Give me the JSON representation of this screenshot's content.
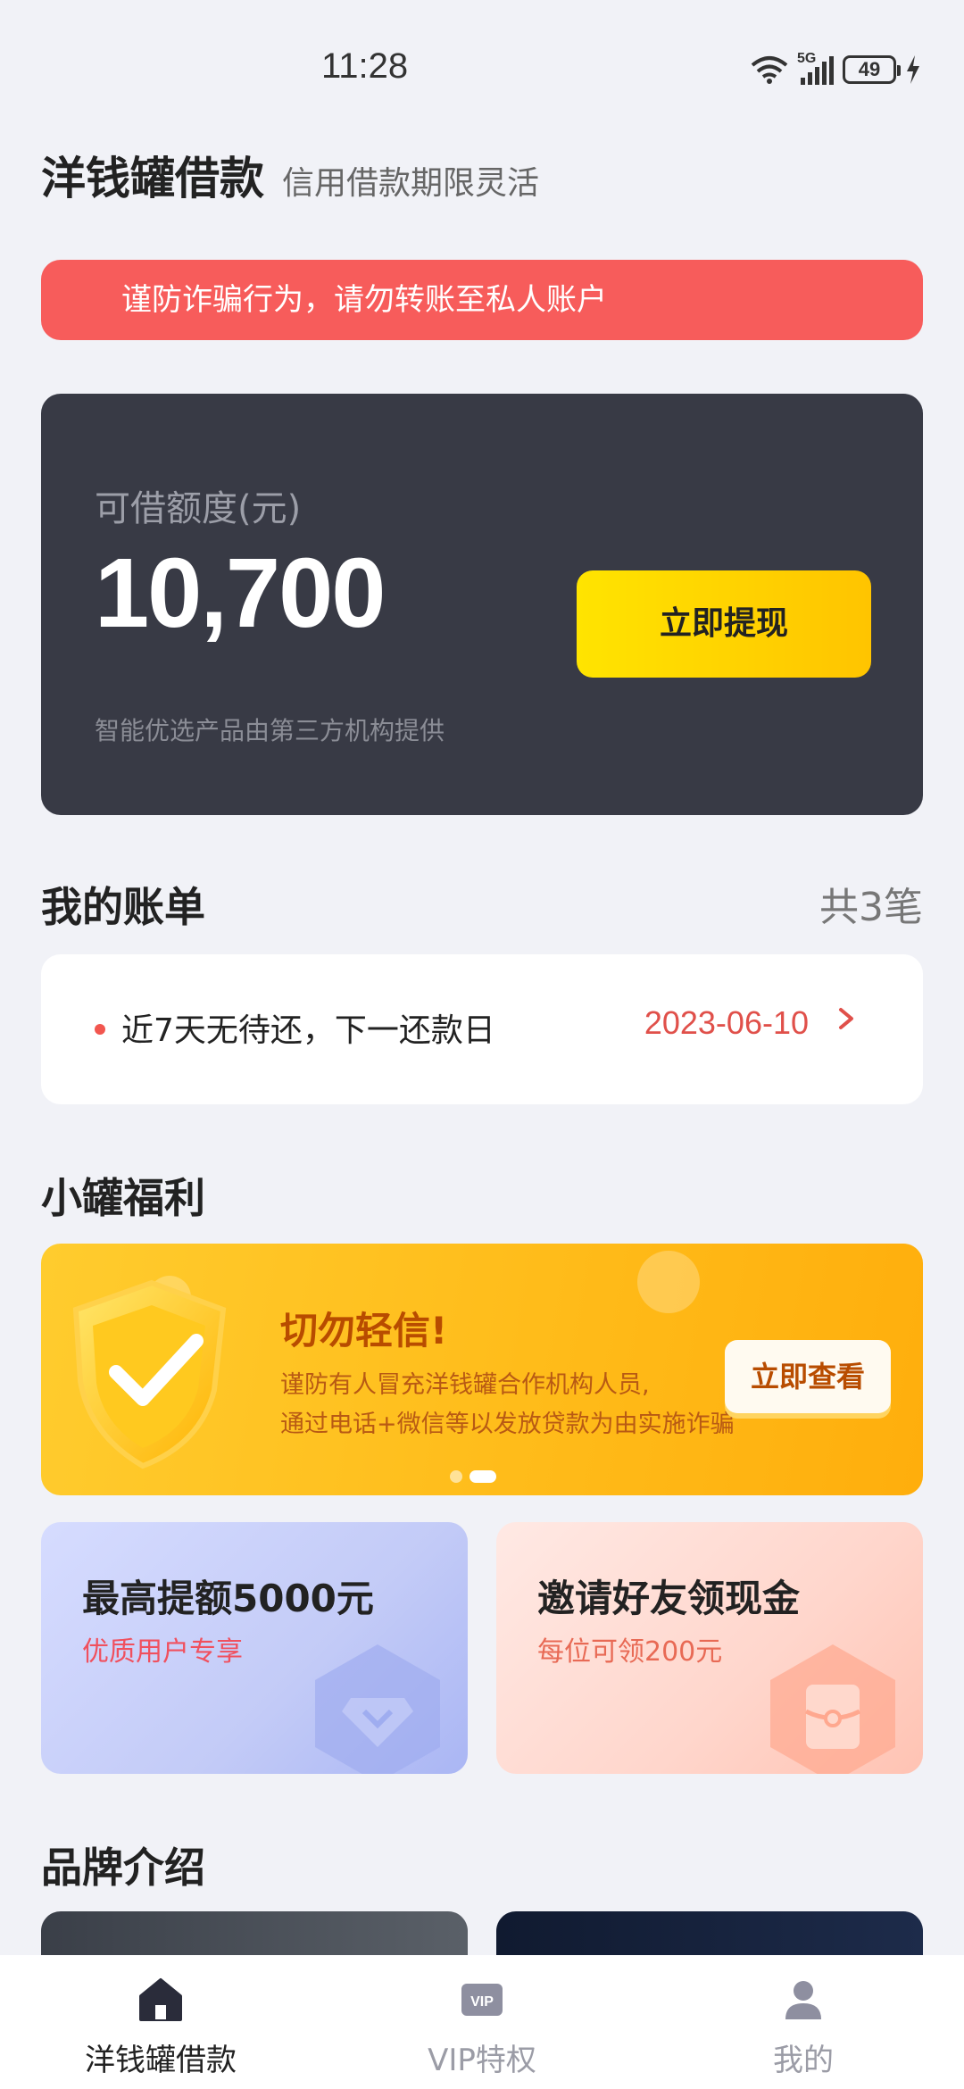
{
  "status_bar": {
    "time": "11:28",
    "network": "5G",
    "battery": "49"
  },
  "header": {
    "title": "洋钱罐借款",
    "subtitle": "信用借款期限灵活"
  },
  "warning": {
    "text": "谨防诈骗行为，请勿转账至私人账户"
  },
  "credit": {
    "label": "可借额度(元)",
    "amount": "10,700",
    "note": "智能优选产品由第三方机构提供",
    "withdraw_label": "立即提现"
  },
  "bills": {
    "title": "我的账单",
    "count": "共3笔",
    "status_text": "近7天无待还，下一还款日",
    "next_date": "2023-06-10"
  },
  "perks": {
    "title": "小罐福利",
    "banner": {
      "title": "切勿轻信!",
      "line1": "谨防有人冒充洋钱罐合作机构人员,",
      "line2": "通过电话+微信等以发放贷款为由实施诈骗",
      "button": "立即查看",
      "active_slide": 2,
      "total_slides": 2
    },
    "cards": [
      {
        "title": "最高提额5000元",
        "subtitle": "优质用户专享",
        "icon": "diamond-icon"
      },
      {
        "title": "邀请好友领现金",
        "subtitle": "每位可领200元",
        "icon": "red-packet-icon"
      }
    ]
  },
  "brand": {
    "title": "品牌介绍"
  },
  "tabbar": {
    "items": [
      {
        "label": "洋钱罐借款",
        "icon": "home-icon",
        "active": true
      },
      {
        "label": "VIP特权",
        "icon": "vip-icon",
        "active": false
      },
      {
        "label": "我的",
        "icon": "user-icon",
        "active": false
      }
    ]
  },
  "colors": {
    "accent_yellow": "#ffd200",
    "warning_red": "#f75c5b",
    "card_dark": "#383a45",
    "date_red": "#e0504a"
  }
}
